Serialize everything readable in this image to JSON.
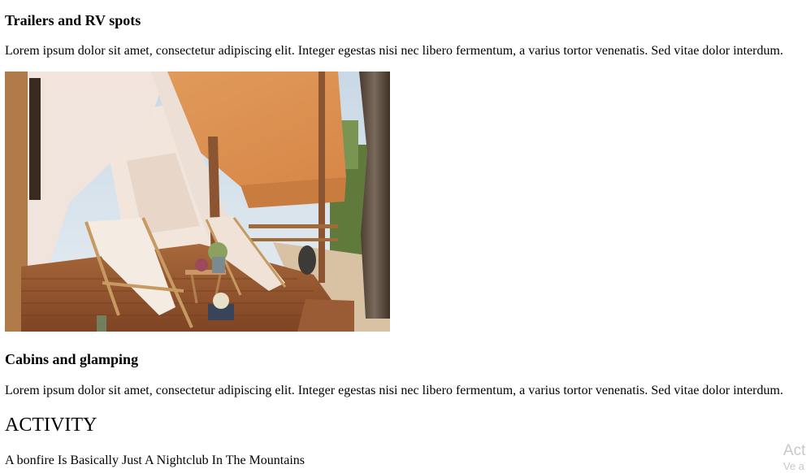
{
  "sections": {
    "trailers": {
      "title": "Trailers and RV spots",
      "body": "Lorem ipsum dolor sit amet, consectetur adipiscing elit. Integer egestas nisi nec libero fermentum, a varius tortor venenatis. Sed vitae dolor interdum."
    },
    "cabins": {
      "title": "Cabins and glamping",
      "body": "Lorem ipsum dolor sit amet, consectetur adipiscing elit. Integer egestas nisi nec libero fermentum, a varius tortor venenatis. Sed vitae dolor interdum."
    },
    "activity": {
      "title": "ACTIVITY",
      "first_item": "A bonfire Is Basically Just A Nightclub In The Mountains"
    }
  },
  "watermark": {
    "line1": "Act",
    "line2": "Ve a"
  }
}
